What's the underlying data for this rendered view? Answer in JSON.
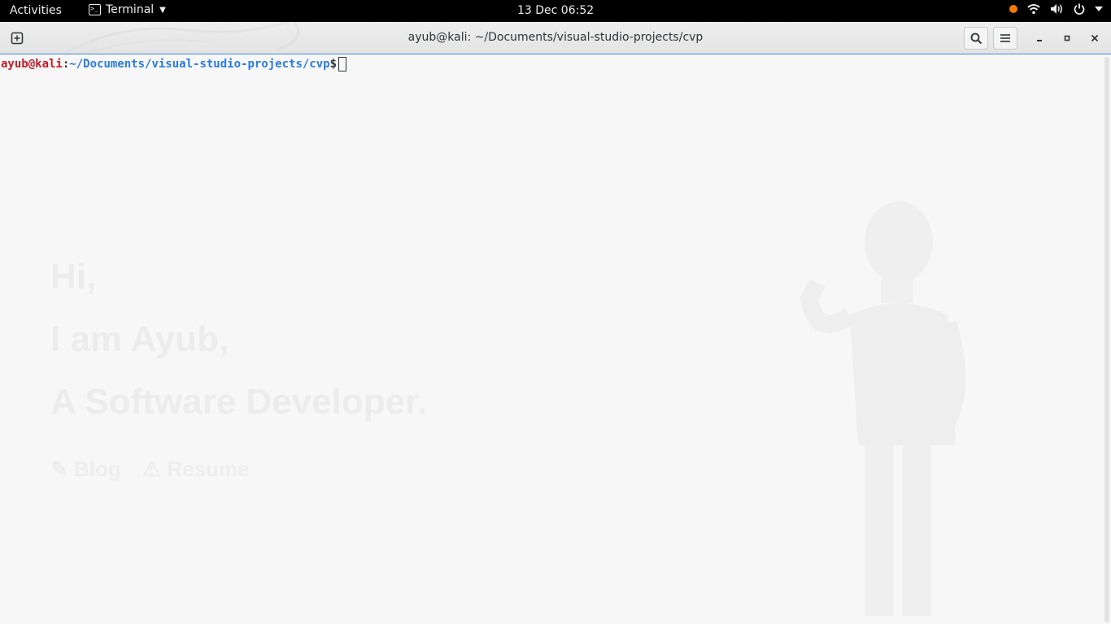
{
  "topbar": {
    "activities": "Activities",
    "app_name": "Terminal",
    "clock": "13 Dec  06:52"
  },
  "window": {
    "title": "ayub@kali: ~/Documents/visual-studio-projects/cvp"
  },
  "terminal": {
    "prompt_user": "ayub@kali",
    "prompt_colon": ":",
    "prompt_path": "~/Documents/visual-studio-projects/cvp",
    "prompt_symbol": "$"
  },
  "background_page": {
    "hero_line1": "Hi,",
    "hero_line2": "I am Ayub,",
    "hero_line3": "A Software Developer.",
    "link_blog": "Blog",
    "link_resume": "Resume"
  },
  "colors": {
    "prompt_user": "#c01c28",
    "prompt_path": "#2a7bde",
    "accent_border": "#4a90d9",
    "recording_dot": "#f57900"
  }
}
